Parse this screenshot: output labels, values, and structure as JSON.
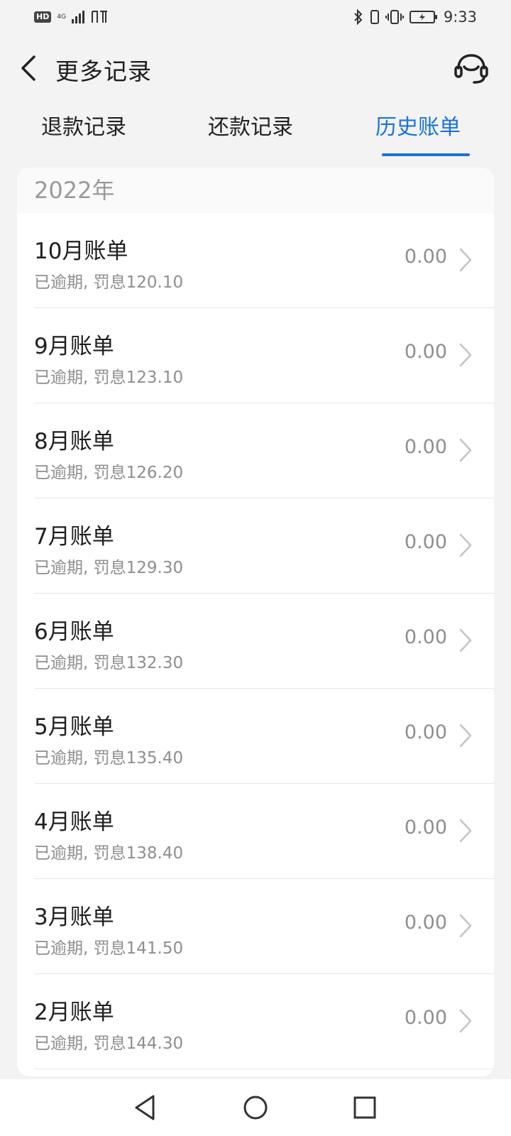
{
  "status_bar": {
    "left_badge": "HD",
    "network": "4G",
    "time": "9:33"
  },
  "header": {
    "title": "更多记录",
    "back_icon": "chevron-left-icon",
    "service_icon": "headset-icon"
  },
  "tabs": [
    {
      "label": "退款记录",
      "active": false
    },
    {
      "label": "还款记录",
      "active": false
    },
    {
      "label": "历史账单",
      "active": true
    }
  ],
  "accent_color": "#1a73d9",
  "list": {
    "year": "2022年",
    "rows": [
      {
        "title": "10月账单",
        "subtitle": "已逾期, 罚息120.10",
        "amount": "0.00"
      },
      {
        "title": "9月账单",
        "subtitle": "已逾期, 罚息123.10",
        "amount": "0.00"
      },
      {
        "title": "8月账单",
        "subtitle": "已逾期, 罚息126.20",
        "amount": "0.00"
      },
      {
        "title": "7月账单",
        "subtitle": "已逾期, 罚息129.30",
        "amount": "0.00"
      },
      {
        "title": "6月账单",
        "subtitle": "已逾期, 罚息132.30",
        "amount": "0.00"
      },
      {
        "title": "5月账单",
        "subtitle": "已逾期, 罚息135.40",
        "amount": "0.00"
      },
      {
        "title": "4月账单",
        "subtitle": "已逾期, 罚息138.40",
        "amount": "0.00"
      },
      {
        "title": "3月账单",
        "subtitle": "已逾期, 罚息141.50",
        "amount": "0.00"
      },
      {
        "title": "2月账单",
        "subtitle": "已逾期, 罚息144.30",
        "amount": "0.00"
      }
    ]
  },
  "navbar": {
    "back": "triangle-back-icon",
    "home": "circle-home-icon",
    "recents": "square-recents-icon"
  }
}
